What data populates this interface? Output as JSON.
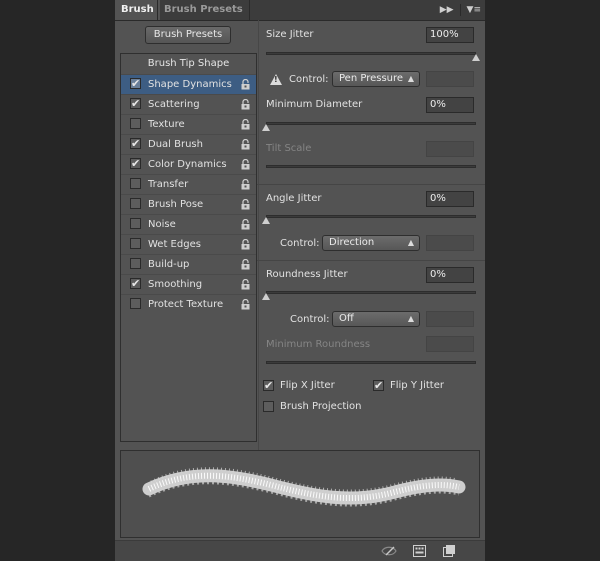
{
  "tabs": {
    "brush": "Brush",
    "brush_presets": "Brush Presets"
  },
  "brush_presets_button": "Brush Presets",
  "brush_tip_shape": "Brush Tip Shape",
  "options": [
    {
      "label": "Shape Dynamics",
      "checked": true,
      "selected": true
    },
    {
      "label": "Scattering",
      "checked": true
    },
    {
      "label": "Texture",
      "checked": false
    },
    {
      "label": "Dual Brush",
      "checked": true
    },
    {
      "label": "Color Dynamics",
      "checked": true
    },
    {
      "label": "Transfer",
      "checked": false
    },
    {
      "label": "Brush Pose",
      "checked": false
    },
    {
      "label": "Noise",
      "checked": false
    },
    {
      "label": "Wet Edges",
      "checked": false
    },
    {
      "label": "Build-up",
      "checked": false
    },
    {
      "label": "Smoothing",
      "checked": true
    },
    {
      "label": "Protect Texture",
      "checked": false
    }
  ],
  "settings": {
    "size_jitter": {
      "label": "Size Jitter",
      "value": "100%",
      "level": 1.0
    },
    "size_control": {
      "label": "Control:",
      "value": "Pen Pressure"
    },
    "minimum_diameter": {
      "label": "Minimum Diameter",
      "value": "0%",
      "level": 0
    },
    "tilt_scale": {
      "label": "Tilt Scale"
    },
    "angle_jitter": {
      "label": "Angle Jitter",
      "value": "0%",
      "level": 0
    },
    "angle_control": {
      "label": "Control:",
      "value": "Direction"
    },
    "roundness_jitter": {
      "label": "Roundness Jitter",
      "value": "0%",
      "level": 0
    },
    "roundness_control": {
      "label": "Control:",
      "value": "Off"
    },
    "minimum_roundness": {
      "label": "Minimum Roundness"
    },
    "flip_x": {
      "label": "Flip X Jitter",
      "checked": true
    },
    "flip_y": {
      "label": "Flip Y Jitter",
      "checked": true
    },
    "brush_projection": {
      "label": "Brush Projection",
      "checked": false
    }
  },
  "icons": [
    "panel-menu-icon",
    "collapse-icon",
    "lock-icon",
    "warning-icon",
    "toggle-preview-icon",
    "grid-icon",
    "new-preset-icon"
  ]
}
